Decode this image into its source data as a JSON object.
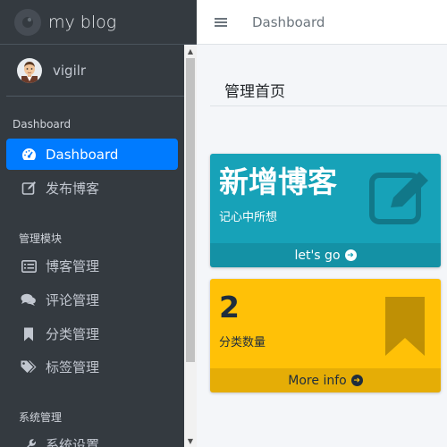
{
  "brand": {
    "name": "my blog"
  },
  "user": {
    "name": "vigilr"
  },
  "sidebar": {
    "sections": [
      {
        "header": "Dashboard"
      },
      {
        "header": "管理模块"
      },
      {
        "header": "系统管理"
      }
    ],
    "items": [
      {
        "label": "Dashboard",
        "icon": "tachometer-icon",
        "active": true
      },
      {
        "label": "发布博客",
        "icon": "edit-icon"
      },
      {
        "label": "博客管理",
        "icon": "list-icon"
      },
      {
        "label": "评论管理",
        "icon": "comments-icon"
      },
      {
        "label": "分类管理",
        "icon": "bookmark-icon"
      },
      {
        "label": "标签管理",
        "icon": "tags-icon"
      },
      {
        "label": "系统设置",
        "icon": "wrench-icon"
      }
    ]
  },
  "topbar": {
    "link": "Dashboard"
  },
  "page": {
    "title": "管理首页"
  },
  "cards": [
    {
      "title": "新增博客",
      "subtitle": "记心中所想",
      "footer": "let's go",
      "color": "#17a2b8",
      "icon": "edit-icon"
    },
    {
      "title": "2",
      "subtitle": "分类数量",
      "footer": "More info",
      "color": "#ffc107",
      "icon": "bookmark-icon"
    }
  ],
  "colors": {
    "sidebar_bg": "#343a40",
    "active": "#007bff",
    "info": "#17a2b8",
    "warning": "#ffc107"
  }
}
